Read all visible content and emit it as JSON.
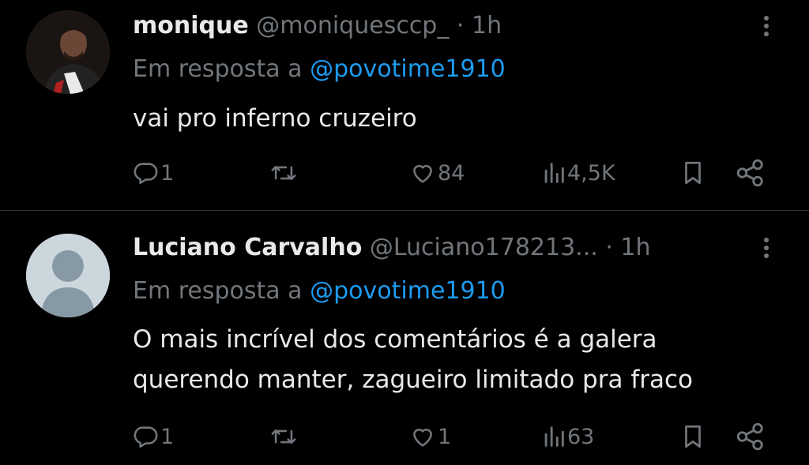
{
  "tweets": [
    {
      "display_name": "monique",
      "handle": "@moniquesccp_",
      "time": "· 1h",
      "reply_prefix": "Em resposta a",
      "reply_mention": "@povotime1910",
      "text": "vai pro inferno cruzeiro",
      "replies": "1",
      "likes": "84",
      "views": "4,5K",
      "avatar": "profile-photo"
    },
    {
      "display_name": "Luciano Carvalho",
      "handle": "@Luciano178213...",
      "time": "· 1h",
      "reply_prefix": "Em resposta a",
      "reply_mention": "@povotime1910",
      "text_line1": "O mais incrível dos comentários é a galera",
      "text_line2": "querendo manter, zagueiro limitado pra fraco",
      "replies": "1",
      "likes": "1",
      "views": "63",
      "avatar": "default-avatar"
    }
  ],
  "icons": {
    "reply": "reply-icon",
    "retweet": "retweet-icon",
    "like": "heart-icon",
    "views": "views-icon",
    "bookmark": "bookmark-icon",
    "share": "share-icon",
    "more": "more-options-icon"
  },
  "colors": {
    "background": "#000000",
    "text": "#e7e9ea",
    "muted": "#71767b",
    "link": "#1d9bf0",
    "divider": "#2f3336"
  }
}
